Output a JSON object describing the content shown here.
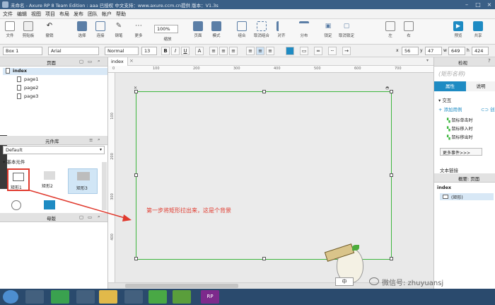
{
  "window": {
    "title": "未命名 - Axure RP 8 Team Edition : aaa 已授权 中文支持：www.axure.ccm.cn提供 版本：V1.3s"
  },
  "menu": [
    "文件",
    "编辑",
    "视图",
    "项目",
    "布局",
    "发布",
    "团队",
    "帐户",
    "帮助"
  ],
  "toolbar": {
    "buttons": [
      "文件",
      "剪贴板",
      "撤销",
      "选择",
      "连接",
      "钢笔",
      "更多",
      "缩放",
      "页面",
      "模式",
      "组合",
      "取消组合",
      "对齐",
      "分布",
      "锁定",
      "取消锁定",
      "左",
      "右",
      "预览",
      "共享"
    ],
    "zoom": "100%"
  },
  "formatbar": {
    "widget": "Box 1",
    "font": "Arial",
    "style": "Normal",
    "size": "13",
    "x": "56",
    "y": "47",
    "w": "649",
    "h": "424"
  },
  "left_panel": {
    "pages_title": "页面",
    "pages": [
      "index",
      "page1",
      "page2",
      "page3"
    ],
    "library_title": "元件库",
    "library_select": "Default",
    "library_group": "基本元件",
    "widgets": [
      "矩形1",
      "矩形2",
      "矩形3"
    ],
    "masters_title": "母版"
  },
  "canvas": {
    "tab": "index",
    "ruler_top": [
      "0",
      "100",
      "200",
      "300",
      "400",
      "500",
      "600",
      "700"
    ],
    "ruler_left": [
      "100",
      "200",
      "300",
      "400"
    ],
    "annotation": "第一步将矩形拉出来，这是个背景"
  },
  "right_panel": {
    "top_title": "检视",
    "widget_name_placeholder": "(矩形名称)",
    "tab_props": "属性",
    "tab_style": "说明",
    "section_interactions": "交互",
    "add_case": "添加用例",
    "create_link": "创建",
    "events": [
      "鼠标单击时",
      "鼠标移入时",
      "鼠标移出时"
    ],
    "more_events": "更多事件>>>",
    "text_link": "文本链接",
    "outline_title": "概要: 页面",
    "outline_page": "index",
    "outline_item": "(矩形)"
  },
  "watermark": {
    "text": "微信号: zhuyuansj"
  },
  "colors": {
    "titlebar": "#3a5f86",
    "accent": "#1e8bc3",
    "selection": "#3db63d",
    "annotation": "#e03a2e"
  }
}
